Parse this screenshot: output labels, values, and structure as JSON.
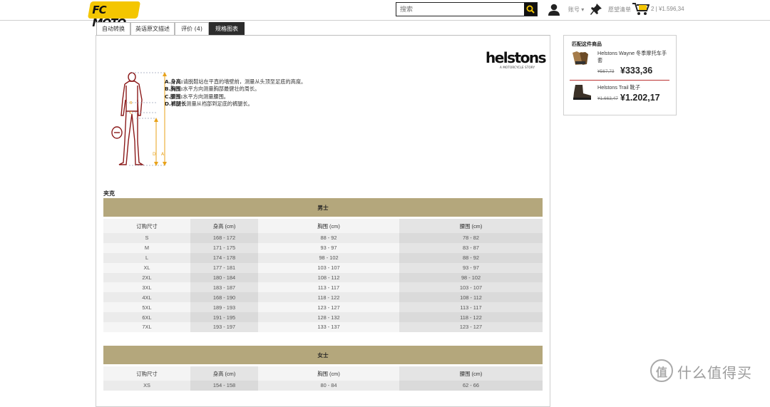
{
  "header": {
    "logo_text": "FC MOTO",
    "search_placeholder": "搜索",
    "account_label": "账号",
    "wishlist_label": "愿望清单",
    "cart_text": "2 | ¥1.596,34"
  },
  "tabs": [
    {
      "label": "自动转换"
    },
    {
      "label": "英语原文描述"
    },
    {
      "label": "评价 (4)"
    },
    {
      "label": "规格图表",
      "active": true
    }
  ],
  "brand": {
    "name": "helstons",
    "tagline": "A MOTORCYCLE STORY"
  },
  "figure_marks": {
    "a": "A",
    "b": "B",
    "c": "C",
    "d": "D"
  },
  "definitions": [
    {
      "term": "A.身高:",
      "text": "请脱鞋站在平直的墙壁前，测量从头顶至足底的高度。"
    },
    {
      "term": "B.胸围:",
      "text": "水平方向测量胸部最健壮的周长。"
    },
    {
      "term": "C.腰围:",
      "text": "水平方向测量腰围。"
    },
    {
      "term": "D.裤腿长",
      "text": "测量从裆部到足底的裤腿长。"
    }
  ],
  "caption": "夹克",
  "size_tables": [
    {
      "group": "男士",
      "headers": [
        "订购尺寸",
        "身高 (cm)",
        "胸围 (cm)",
        "腰围 (cm)"
      ],
      "rows": [
        [
          "S",
          "168 - 172",
          "88 - 92",
          "78 - 82"
        ],
        [
          "M",
          "171 - 175",
          "93 - 97",
          "83 - 87"
        ],
        [
          "L",
          "174 - 178",
          "98 - 102",
          "88 - 92"
        ],
        [
          "XL",
          "177 - 181",
          "103 - 107",
          "93 - 97"
        ],
        [
          "2XL",
          "180 - 184",
          "108 - 112",
          "98 - 102"
        ],
        [
          "3XL",
          "183 - 187",
          "113 - 117",
          "103 - 107"
        ],
        [
          "4XL",
          "168 - 190",
          "118 - 122",
          "108 - 112"
        ],
        [
          "5XL",
          "189 - 193",
          "123 - 127",
          "113 - 117"
        ],
        [
          "6XL",
          "191 - 195",
          "128 - 132",
          "118 - 122"
        ],
        [
          "7XL",
          "193 - 197",
          "133 - 137",
          "123 - 127"
        ]
      ]
    },
    {
      "group": "女士",
      "headers": [
        "订购尺寸",
        "身高 (cm)",
        "胸围 (cm)",
        "腰围 (cm)"
      ],
      "rows": [
        [
          "XS",
          "154 - 158",
          "80 - 84",
          "62 - 66"
        ]
      ]
    }
  ],
  "sidebar": {
    "title": "匹配这件商品",
    "products": [
      {
        "name": "Helstons Wayne 冬季摩托车手套",
        "old_price": "¥567,73",
        "price": "¥333,36",
        "icon": "glove-icon"
      },
      {
        "name": "Helstons Trail 靴子",
        "old_price": "¥1.663,47",
        "price": "¥1.202,17",
        "icon": "boot-icon"
      }
    ]
  },
  "watermark": {
    "symbol": "值",
    "text": "什么值得买"
  },
  "colors": {
    "table_header": "#b4a77c",
    "active_tab": "#2d2d2d",
    "logo": "#f4c600",
    "figure": "#8b1a1a",
    "measure_lines": "#e8a21a"
  }
}
